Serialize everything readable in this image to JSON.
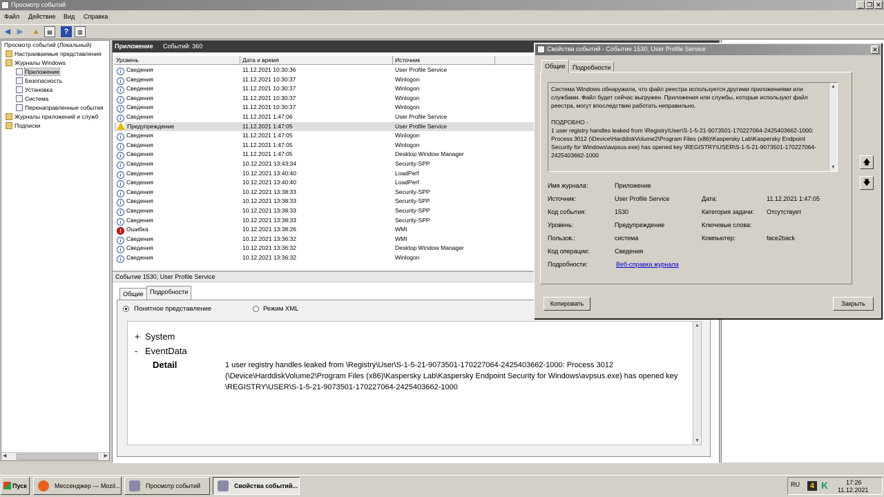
{
  "window": {
    "title": "Просмотр событий",
    "controls": [
      "_",
      "❐",
      "✕"
    ]
  },
  "menu": [
    "Файл",
    "Действие",
    "Вид",
    "Справка"
  ],
  "toolbar": [
    "back-icon",
    "forward-icon",
    "up-folder-icon",
    "show-hide-tree-icon",
    "help-icon",
    "properties-icon"
  ],
  "tree": {
    "items": [
      {
        "label": "Просмотр событий (Локальный)",
        "icon": "computer-icon"
      },
      {
        "label": "Настраиваемые представления",
        "icon": "folder-icon"
      },
      {
        "label": "Журналы Windows",
        "icon": "folder-icon"
      },
      {
        "label": "Приложение",
        "icon": "log-icon"
      },
      {
        "label": "Безопасность",
        "icon": "log-icon"
      },
      {
        "label": "Установка",
        "icon": "log-icon"
      },
      {
        "label": "Система",
        "icon": "log-icon"
      },
      {
        "label": "Перенаправленные события",
        "icon": "log-icon"
      },
      {
        "label": "Журналы приложений и служб",
        "icon": "folder-icon"
      },
      {
        "label": "Подписки",
        "icon": "folder-icon"
      }
    ]
  },
  "list": {
    "title": "Приложение",
    "count": "Событий: 360",
    "columns": [
      "Уровень",
      "Дата и время",
      "Источник"
    ],
    "rows": [
      {
        "level": "Сведения",
        "type": "info",
        "date": "11.12.2021 10:30:36",
        "source": "User Profile Service"
      },
      {
        "level": "Сведения",
        "type": "info",
        "date": "11.12.2021 10:30:37",
        "source": "Winlogon"
      },
      {
        "level": "Сведения",
        "type": "info",
        "date": "11.12.2021 10:30:37",
        "source": "Winlogon"
      },
      {
        "level": "Сведения",
        "type": "info",
        "date": "11.12.2021 10:30:37",
        "source": "Winlogon"
      },
      {
        "level": "Сведения",
        "type": "info",
        "date": "11.12.2021 10:30:37",
        "source": "Winlogon"
      },
      {
        "level": "Сведения",
        "type": "info",
        "date": "11.12.2021 1:47:06",
        "source": "User Profile Service"
      },
      {
        "level": "Предупреждение",
        "type": "warn",
        "date": "11.12.2021 1:47:05",
        "source": "User Profile Service"
      },
      {
        "level": "Сведения",
        "type": "info",
        "date": "11.12.2021 1:47:05",
        "source": "Winlogon"
      },
      {
        "level": "Сведения",
        "type": "info",
        "date": "11.12.2021 1:47:05",
        "source": "Winlogon"
      },
      {
        "level": "Сведения",
        "type": "info",
        "date": "11.12.2021 1:47:05",
        "source": "Desktop Window Manager"
      },
      {
        "level": "Сведения",
        "type": "info",
        "date": "10.12.2021 13:43:34",
        "source": "Security-SPP"
      },
      {
        "level": "Сведения",
        "type": "info",
        "date": "10.12.2021 13:40:40",
        "source": "LoadPerf"
      },
      {
        "level": "Сведения",
        "type": "info",
        "date": "10.12.2021 13:40:40",
        "source": "LoadPerf"
      },
      {
        "level": "Сведения",
        "type": "info",
        "date": "10.12.2021 13:38:33",
        "source": "Security-SPP"
      },
      {
        "level": "Сведения",
        "type": "info",
        "date": "10.12.2021 13:38:33",
        "source": "Security-SPP"
      },
      {
        "level": "Сведения",
        "type": "info",
        "date": "10.12.2021 13:38:33",
        "source": "Security-SPP"
      },
      {
        "level": "Сведения",
        "type": "info",
        "date": "10.12.2021 13:38:33",
        "source": "Security-SPP"
      },
      {
        "level": "Ошибка",
        "type": "err",
        "date": "10.12.2021 13:38:26",
        "source": "WMI"
      },
      {
        "level": "Сведения",
        "type": "info",
        "date": "10.12.2021 13:36:32",
        "source": "WMI"
      },
      {
        "level": "Сведения",
        "type": "info",
        "date": "10.12.2021 13:36:32",
        "source": "Desktop Window Manager"
      },
      {
        "level": "Сведения",
        "type": "info",
        "date": "10.12.2021 13:36:32",
        "source": "Winlogon"
      }
    ]
  },
  "detail": {
    "header": "Событие 1530, User Profile Service",
    "tabs": [
      "Общие",
      "Подробности"
    ],
    "radio_friendly": "Понятное представление",
    "radio_xml": "Режим XML",
    "system_label": "System",
    "eventdata_label": "EventData",
    "plus": "+",
    "minus": "-",
    "detail_label": "Detail",
    "detail_text": "1 user registry handles leaked from \\Registry\\User\\S-1-5-21-9073501-170227064-2425403662-1000: Process 3012 (\\Device\\HarddiskVolume2\\Program Files (x86)\\Kaspersky Lab\\Kaspersky Endpoint Security for Windows\\avpsus.exe) has opened key \\REGISTRY\\USER\\S-1-5-21-9073501-170227064-2425403662-1000"
  },
  "dialog": {
    "title": "Свойства событий - Событие 1530, User Profile Service",
    "tabs": [
      "Общие",
      "Подробности"
    ],
    "description_p1": "Система Windows обнаружила, что файл реестра используется другими приложениями или службами. Файл будет сейчас выгружен. Приложения или службы, которые используют файл реестра, могут впоследствии работать неправильно.",
    "description_p2": "ПОДРОБНО -",
    "description_p3": " 1 user registry handles leaked from \\Registry\\User\\S-1-5-21-9073501-170227064-2425403662-1000:",
    "description_p4": "Process 3012 (\\Device\\HarddiskVolume2\\Program Files (x86)\\Kaspersky Lab\\Kaspersky Endpoint Security for Windows\\avpsus.exe) has opened key \\REGISTRY\\USER\\S-1-5-21-9073501-170227064-2425403662-1000",
    "fields": {
      "log_name_label": "Имя журнала:",
      "log_name": "Приложение",
      "source_label": "Источник:",
      "source": "User Profile Service",
      "date_label": "Дата:",
      "date": "11.12.2021 1:47:05",
      "event_id_label": "Код события:",
      "event_id": "1530",
      "task_label": "Категория задачи:",
      "task": "Отсутствует",
      "level_label": "Уровень:",
      "level": "Предупреждение",
      "keywords_label": "Ключевые слова:",
      "user_label": "Пользов.:",
      "user": "система",
      "computer_label": "Компьютер:",
      "computer": "face2back",
      "opcode_label": "Код операции:",
      "opcode": "Сведения",
      "more_label": "Подробности:",
      "more_link": "Веб-справка журнала "
    },
    "copy_button": "Копировать",
    "close_button": "Закрыть"
  },
  "taskbar": {
    "start": "Пуск",
    "tasks": [
      {
        "label": "Мессенджер — Mozil...",
        "icon": "firefox-icon",
        "color": "#e8601c"
      },
      {
        "label": "Просмотр событий",
        "icon": "event-viewer-icon",
        "color": "#8a8aa8"
      },
      {
        "label": "Свойства событий...",
        "icon": "event-viewer-icon",
        "color": "#8a8aa8"
      }
    ],
    "lang": "RU",
    "tray_icons": [
      "4",
      "K"
    ],
    "time": "17:26",
    "date": "11.12.2021"
  }
}
